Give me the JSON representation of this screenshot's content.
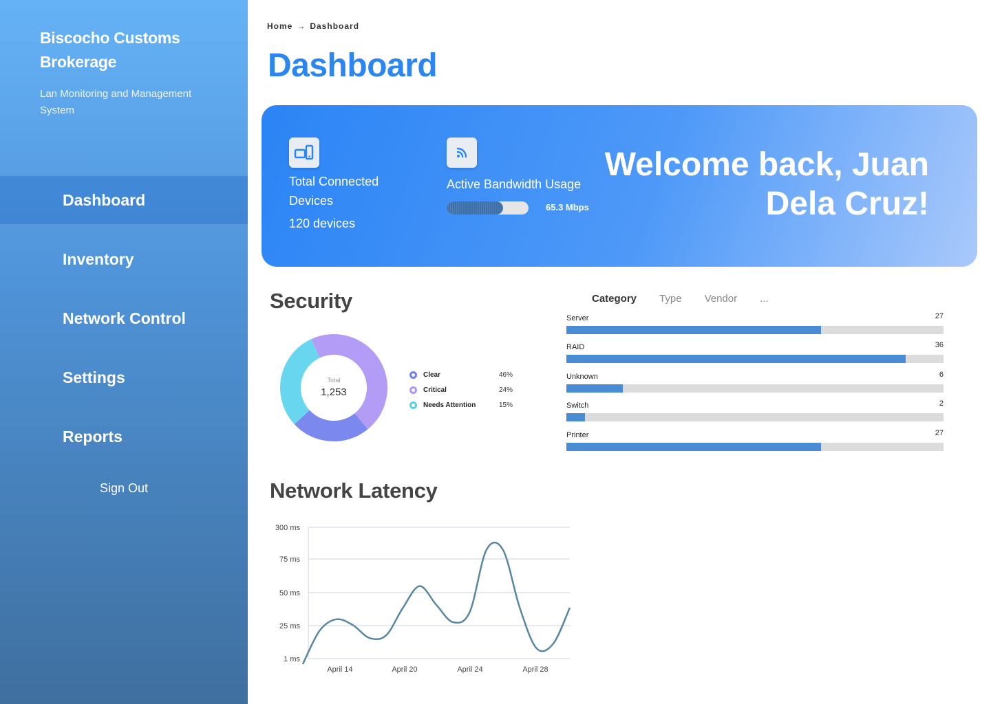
{
  "sidebar": {
    "brand": "Biscocho Customs Brokerage",
    "subtitle": "Lan Monitoring and Management System",
    "items": [
      {
        "label": "Dashboard",
        "active": true
      },
      {
        "label": "Inventory",
        "active": false
      },
      {
        "label": "Network Control",
        "active": false
      },
      {
        "label": "Settings",
        "active": false
      },
      {
        "label": "Reports",
        "active": false
      }
    ],
    "sign_out": "Sign Out"
  },
  "breadcrumb": {
    "home": "Home",
    "separator_icon": "arrow-right-icon",
    "current": "Dashboard"
  },
  "page_title": "Dashboard",
  "hero": {
    "devices": {
      "icon": "devices-icon",
      "label": "Total Connected Devices",
      "value": "120 devices"
    },
    "bandwidth": {
      "icon": "wifi-icon",
      "label": "Active Bandwidth Usage",
      "value": "65.3 Mbps",
      "fill": 0.69
    },
    "welcome": "Welcome back, Juan Dela Cruz!"
  },
  "security": {
    "title": "Security",
    "total_label": "Total",
    "total_value": "1,253",
    "legend": [
      {
        "label": "Clear",
        "pct": "46%",
        "color": "#6f7fe6"
      },
      {
        "label": "Critical",
        "pct": "24%",
        "color": "#b294f3"
      },
      {
        "label": "Needs Attention",
        "pct": "15%",
        "color": "#5ccde8"
      }
    ]
  },
  "inventory_breakdown": {
    "tabs": [
      "Category",
      "Type",
      "Vendor",
      "..."
    ],
    "active_tab": "Category",
    "max": 40,
    "rows": [
      {
        "label": "Server",
        "count": "27",
        "value": 27
      },
      {
        "label": "RAID",
        "count": "36",
        "value": 36
      },
      {
        "label": "Unknown",
        "count": "6",
        "value": 6
      },
      {
        "label": "Switch",
        "count": "2",
        "value": 2
      },
      {
        "label": "Printer",
        "count": "27",
        "value": 27
      }
    ]
  },
  "latency": {
    "title": "Network Latency"
  },
  "colors": {
    "accent": "#2b86f0",
    "bar": "#4a8bd6",
    "line": "#5a86a0"
  },
  "chart_data": [
    {
      "type": "pie",
      "title": "",
      "categories": [
        "Purple segment",
        "Indigo segment",
        "Cyan segment"
      ],
      "values": [
        46,
        24,
        30
      ],
      "center_label": "Total 1,253"
    },
    {
      "type": "bar",
      "categories": [
        "Server",
        "RAID",
        "Unknown",
        "Switch",
        "Printer"
      ],
      "values": [
        27,
        36,
        6,
        2,
        27
      ]
    },
    {
      "type": "line",
      "title": "Network Latency",
      "y_ticks": [
        "1 ms",
        "25 ms",
        "50 ms",
        "75 ms",
        "300 ms"
      ],
      "x_ticks": [
        "April 14",
        "April 20",
        "April 24",
        "April 28"
      ],
      "series": [
        {
          "values": [
            1,
            24,
            32,
            28,
            19,
            21,
            40,
            55,
            42,
            30,
            37,
            80,
            80,
            40,
            12,
            15,
            40
          ]
        }
      ],
      "grid": true
    }
  ]
}
